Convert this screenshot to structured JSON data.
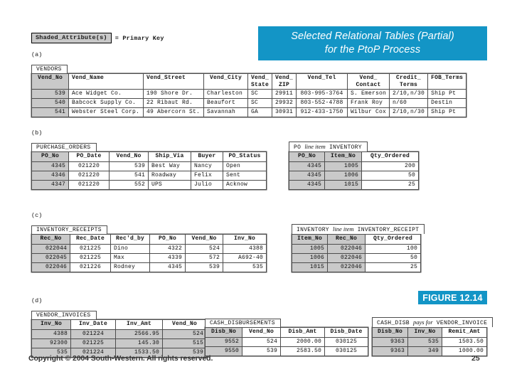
{
  "banner": {
    "line1": "Selected Relational Tables (Partial)",
    "line2": "for the PtoP Process",
    "color": "#1395c6"
  },
  "figure": {
    "label": "FIGURE 12.14",
    "color": "#1395c6"
  },
  "footer": {
    "copyright": "Copyright © 2004 South-Western. All rights reserved.",
    "page_number": "25"
  },
  "legend": {
    "box_text": "Shaded_Attribute(s)",
    "equals_text": "= Primary Key"
  },
  "sections": {
    "a": "(a)",
    "b": "(b)",
    "c": "(c)",
    "d": "(d)"
  },
  "tables": {
    "vendors": {
      "caption": "VENDORS",
      "headers": [
        "Vend_No",
        "Vend_Name",
        "Vend_Street",
        "Vend_City",
        "Vend_\nState",
        "Vend_\nZIP",
        "Vend_Tel",
        "Vend_\nContact",
        "Credit_\nTerms",
        "FOB_Terms"
      ],
      "rows": [
        [
          "539",
          "Ace Widget Co.",
          "190 Shore Dr.",
          "Charleston",
          "SC",
          "29911",
          "803-995-3764",
          "S. Emerson",
          "2/10,n/30",
          "Ship Pt"
        ],
        [
          "540",
          "Babcock Supply Co.",
          "22 Ribaut Rd.",
          "Beaufort",
          "SC",
          "29932",
          "803-552-4788",
          "Frank Roy",
          "n/60",
          "Destin"
        ],
        [
          "541",
          "Webster Steel Corp.",
          "49 Abercorn St.",
          "Savannah",
          "GA",
          "30931",
          "912-433-1750",
          "Wilbur Cox",
          "2/10,n/30",
          "Ship Pt"
        ]
      ]
    },
    "purchase_orders": {
      "caption": "PURCHASE_ORDERS",
      "headers": [
        "PO_No",
        "PO_Date",
        "Vend_No",
        "Ship_Via",
        "Buyer",
        "PO_Status"
      ],
      "rows": [
        [
          "4345",
          "021220",
          "539",
          "Best Way",
          "Nancy",
          "Open"
        ],
        [
          "4346",
          "021220",
          "541",
          "Roadway",
          "Felix",
          "Sent"
        ],
        [
          "4347",
          "021220",
          "552",
          "UPS",
          "Julio",
          "Acknow"
        ]
      ]
    },
    "po_line_item_inventory": {
      "caption_pre": "PO",
      "caption_ital": "line item",
      "caption_post": "INVENTORY",
      "headers": [
        "PO_No",
        "Item_No",
        "Qty_Ordered"
      ],
      "rows": [
        [
          "4345",
          "1005",
          "200"
        ],
        [
          "4345",
          "1006",
          "50"
        ],
        [
          "4345",
          "1015",
          "25"
        ]
      ]
    },
    "inventory_receipts": {
      "caption": "INVENTORY_RECEIPTS",
      "headers": [
        "Rec_No",
        "Rec_Date",
        "Rec'd_by",
        "PO_No",
        "Vend_No",
        "Inv_No"
      ],
      "rows": [
        [
          "022044",
          "021225",
          "Dino",
          "4322",
          "524",
          "4388"
        ],
        [
          "022045",
          "021225",
          "Max",
          "4339",
          "572",
          "A692-40"
        ],
        [
          "022046",
          "021226",
          "Rodney",
          "4345",
          "539",
          "535"
        ]
      ]
    },
    "inventory_line_item_receipt": {
      "caption_pre": "INVENTORY",
      "caption_ital": "line item",
      "caption_post": "INVENTORY_RECEIPT",
      "headers": [
        "Item_No",
        "Rec_No",
        "Qty_Ordered"
      ],
      "rows": [
        [
          "1005",
          "022046",
          "100"
        ],
        [
          "1006",
          "022046",
          "50"
        ],
        [
          "1015",
          "022046",
          "25"
        ]
      ]
    },
    "vendor_invoices": {
      "caption": "VENDOR_INVOICES",
      "headers": [
        "Inv_No",
        "Inv_Date",
        "Inv_Amt",
        "Vend_No"
      ],
      "rows": [
        [
          "4388",
          "021224",
          "2566.95",
          "524"
        ],
        [
          "92300",
          "021225",
          "145.30",
          "515"
        ],
        [
          "535",
          "021224",
          "1533.50",
          "539"
        ]
      ]
    },
    "cash_disbursements": {
      "caption": "CASH_DISBURSEMENTS",
      "headers": [
        "Disb_No",
        "Vend_No",
        "Disb_Amt",
        "Disb_Date"
      ],
      "rows": [
        [
          "9552",
          "524",
          "2000.00",
          "030125"
        ],
        [
          "9550",
          "539",
          "2583.50",
          "030125"
        ]
      ]
    },
    "cash_disb_pays_invoice": {
      "caption_pre": "CASH_DISB",
      "caption_ital": "pays for",
      "caption_post": "VENDOR_INVOICE",
      "headers": [
        "Disb_No",
        "Inv_No",
        "Remit_Amt"
      ],
      "rows": [
        [
          "9363",
          "535",
          "1503.50",
          ""
        ],
        [
          "9363",
          "349",
          "1000.00",
          ""
        ]
      ]
    }
  }
}
